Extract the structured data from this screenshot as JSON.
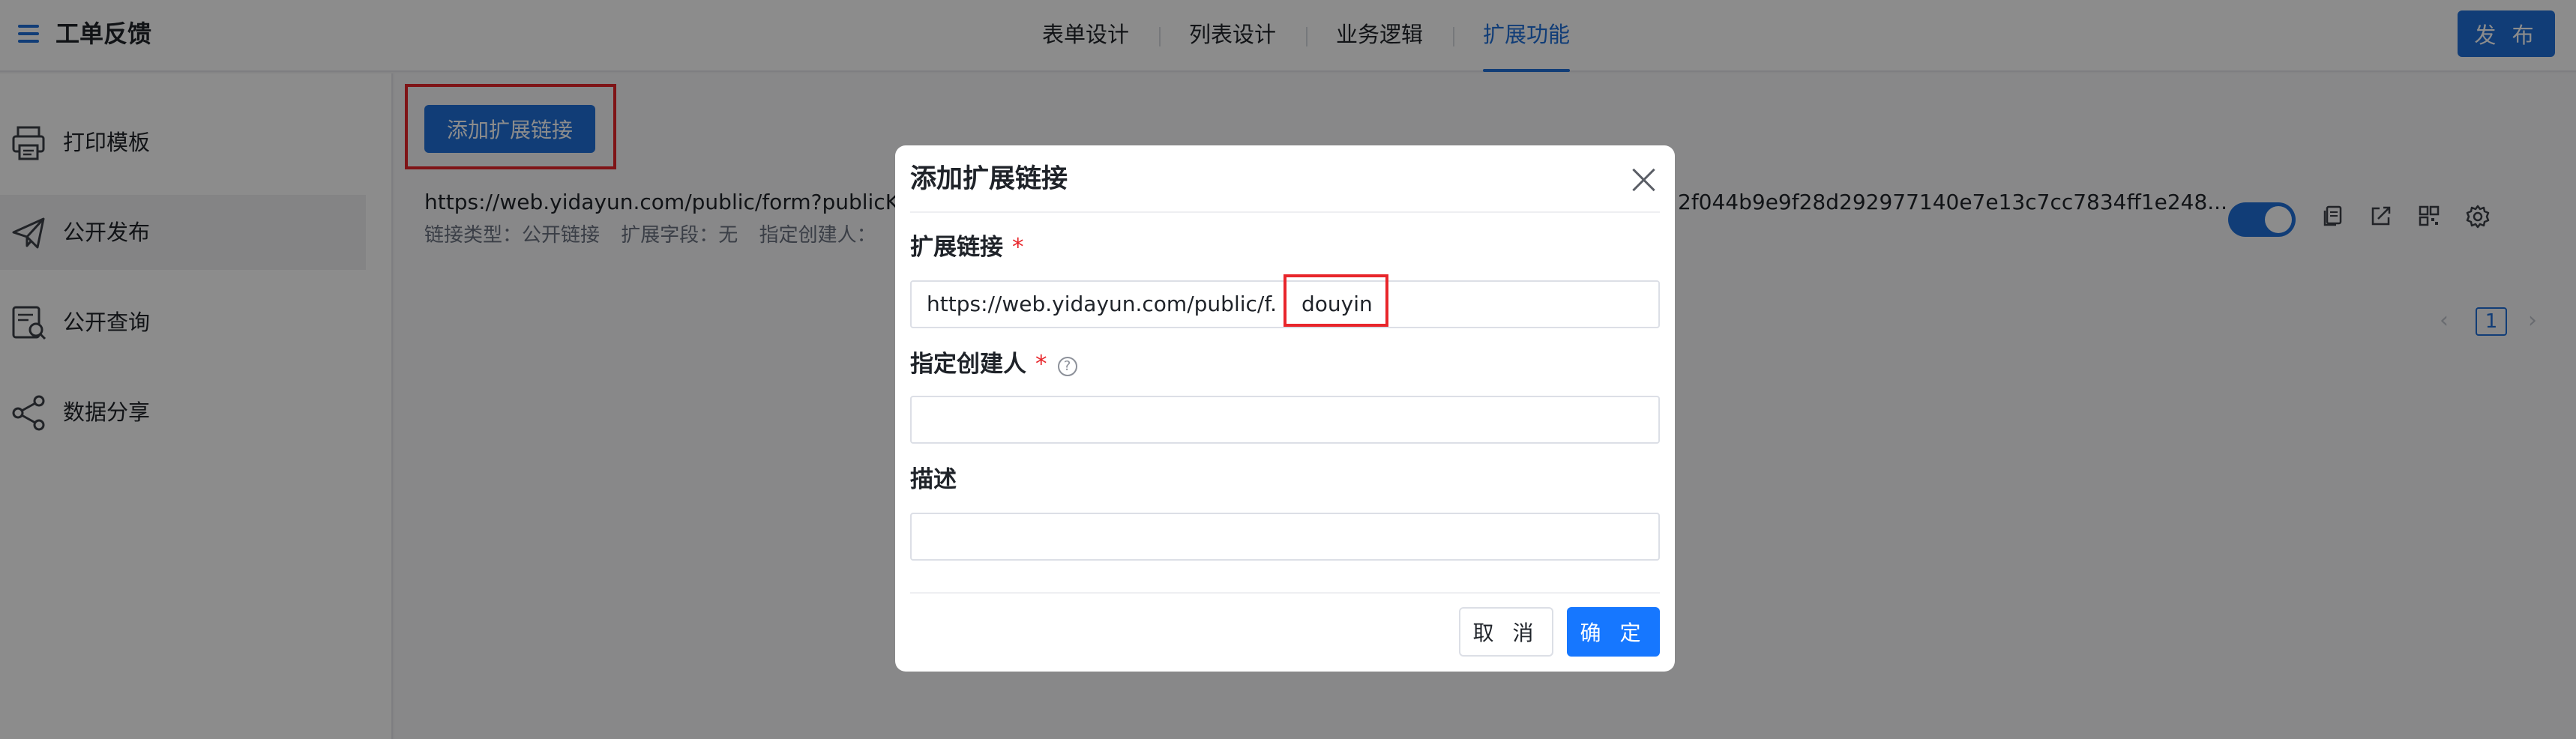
{
  "app": {
    "title": "工单反馈",
    "publish_label": "发 布"
  },
  "nav": {
    "tabs": [
      {
        "label": "表单设计"
      },
      {
        "label": "列表设计"
      },
      {
        "label": "业务逻辑"
      },
      {
        "label": "扩展功能",
        "active": true
      }
    ]
  },
  "sidebar": {
    "items": [
      {
        "label": "打印模板",
        "icon": "printer-icon"
      },
      {
        "label": "公开发布",
        "icon": "paper-plane-icon",
        "active": true
      },
      {
        "label": "公开查询",
        "icon": "document-search-icon"
      },
      {
        "label": "数据分享",
        "icon": "share-icon"
      }
    ]
  },
  "main": {
    "add_link_label": "添加扩展链接",
    "link_row": {
      "url": "https://web.yidayun.com/public/form?publicKey",
      "url_tail": "2f044b9e9f28d292977140e7e13c7cc7834ff1e248...",
      "meta_type": "链接类型：公开链接",
      "meta_field": "扩展字段：无",
      "meta_creator": "指定创建人：",
      "enabled": true
    },
    "pagination": {
      "prev": "‹",
      "current": "1",
      "next": "›"
    }
  },
  "modal": {
    "title": "添加扩展链接",
    "fields": {
      "link_label": "扩展链接",
      "link_prefix": "https://web.yidayun.com/public/f...",
      "link_suffix": "douyin",
      "creator_label": "指定创建人",
      "creator_help": "?",
      "description_label": "描述"
    },
    "required_mark": "*",
    "cancel_label": "取 消",
    "ok_label": "确 定"
  },
  "colors": {
    "primary": "#1f6fd9",
    "modal_ok": "#1677ff",
    "highlight": "#e8262b",
    "required": "#e8262b"
  }
}
